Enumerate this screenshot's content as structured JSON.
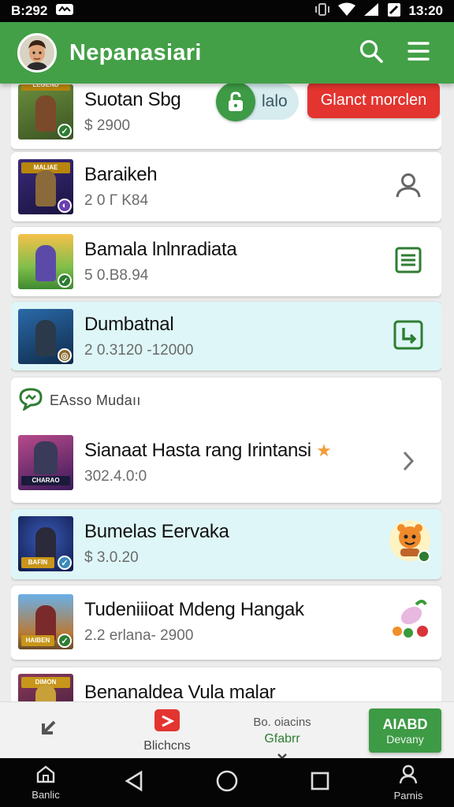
{
  "status_bar": {
    "time_left": "B:292",
    "time_right": "13:20"
  },
  "app_bar": {
    "title": "Nepanasiari",
    "icons": [
      "search-icon",
      "menu-icon"
    ]
  },
  "items": [
    {
      "title": "Suotan Sbg",
      "subtitle": "$ 2900",
      "toggle_label": "lalo",
      "button_label": "Glanct morclen"
    },
    {
      "title": "Baraikeh",
      "subtitle": "2 0 Г K84",
      "action_icon": "person-icon"
    },
    {
      "title": "Bamala lnlnradiata",
      "subtitle": "5 0.B8.94",
      "action_icon": "list-icon"
    },
    {
      "title": "Dumbatnal",
      "subtitle": "2 0.3120 -12000",
      "action_icon": "return-icon"
    }
  ],
  "section": {
    "label": "EAsso Mudaıı",
    "items": [
      {
        "title": "Sianaat Hasta rang Irintansi",
        "subtitle": "302.4.0:0",
        "action_icon": "chevron-right-icon"
      },
      {
        "title": "Bumelas Eervaka",
        "subtitle": "$ 3.0.20",
        "action_icon": "mascot-icon"
      },
      {
        "title": "Tudeniiioat Mdeng Hangak",
        "subtitle": "2.2 erlana- 2900",
        "action_icon": "candy-icon"
      },
      {
        "title": "Benanaldea Vula malar",
        "subtitle": ""
      }
    ]
  },
  "bottom_bar": {
    "back_label": "",
    "video_label": "Blichcns",
    "center_line1": "Bo. oiacins",
    "center_line2": "Gfabrr",
    "primary_line1": "AIABD",
    "primary_line2": "Devany"
  },
  "system_nav": {
    "home_label": "Banlic",
    "profile_label": "Parnis"
  },
  "colors": {
    "primary_green": "#43a047",
    "accent_red": "#e3342f",
    "tint_cyan": "#def6f7"
  }
}
